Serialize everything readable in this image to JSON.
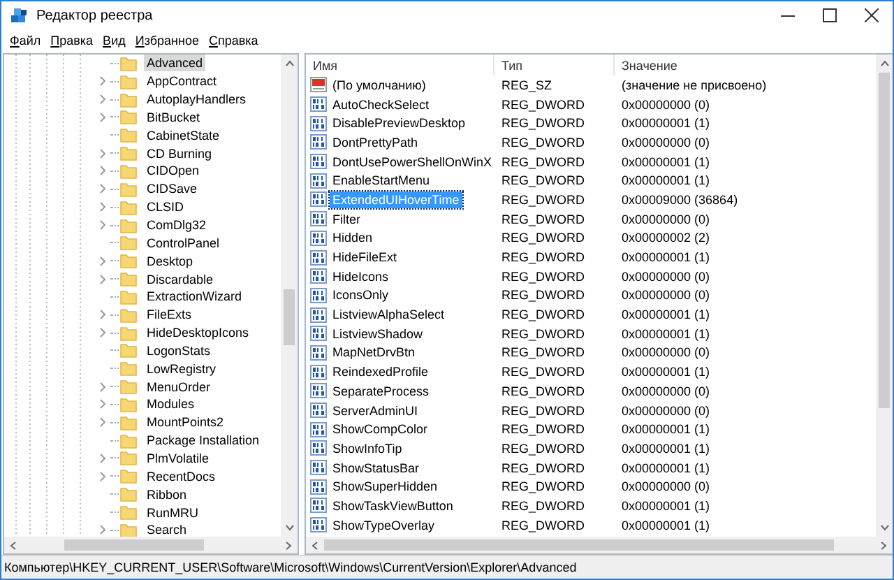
{
  "window": {
    "title": "Редактор реестра"
  },
  "menu": [
    "Файл",
    "Правка",
    "Вид",
    "Избранное",
    "Справка"
  ],
  "tree": [
    {
      "label": "Advanced",
      "expandable": false,
      "selected": true
    },
    {
      "label": "AppContract",
      "expandable": true,
      "selected": false
    },
    {
      "label": "AutoplayHandlers",
      "expandable": true,
      "selected": false
    },
    {
      "label": "BitBucket",
      "expandable": true,
      "selected": false
    },
    {
      "label": "CabinetState",
      "expandable": false,
      "selected": false
    },
    {
      "label": "CD Burning",
      "expandable": true,
      "selected": false
    },
    {
      "label": "CIDOpen",
      "expandable": true,
      "selected": false
    },
    {
      "label": "CIDSave",
      "expandable": true,
      "selected": false
    },
    {
      "label": "CLSID",
      "expandable": true,
      "selected": false
    },
    {
      "label": "ComDlg32",
      "expandable": true,
      "selected": false
    },
    {
      "label": "ControlPanel",
      "expandable": false,
      "selected": false
    },
    {
      "label": "Desktop",
      "expandable": true,
      "selected": false
    },
    {
      "label": "Discardable",
      "expandable": true,
      "selected": false
    },
    {
      "label": "ExtractionWizard",
      "expandable": false,
      "selected": false
    },
    {
      "label": "FileExts",
      "expandable": true,
      "selected": false
    },
    {
      "label": "HideDesktopIcons",
      "expandable": true,
      "selected": false
    },
    {
      "label": "LogonStats",
      "expandable": false,
      "selected": false
    },
    {
      "label": "LowRegistry",
      "expandable": false,
      "selected": false
    },
    {
      "label": "MenuOrder",
      "expandable": true,
      "selected": false
    },
    {
      "label": "Modules",
      "expandable": true,
      "selected": false
    },
    {
      "label": "MountPoints2",
      "expandable": true,
      "selected": false
    },
    {
      "label": "Package Installation",
      "expandable": false,
      "selected": false
    },
    {
      "label": "PlmVolatile",
      "expandable": true,
      "selected": false
    },
    {
      "label": "RecentDocs",
      "expandable": true,
      "selected": false
    },
    {
      "label": "Ribbon",
      "expandable": false,
      "selected": false
    },
    {
      "label": "RunMRU",
      "expandable": false,
      "selected": false
    },
    {
      "label": "Search",
      "expandable": true,
      "selected": false
    }
  ],
  "columns": [
    "Имя",
    "Тип",
    "Значение"
  ],
  "values": [
    {
      "kind": "string",
      "name": "(По умолчанию)",
      "type": "REG_SZ",
      "data": "(значение не присвоено)",
      "selected": false
    },
    {
      "kind": "dword",
      "name": "AutoCheckSelect",
      "type": "REG_DWORD",
      "data": "0x00000000 (0)",
      "selected": false
    },
    {
      "kind": "dword",
      "name": "DisablePreviewDesktop",
      "type": "REG_DWORD",
      "data": "0x00000001 (1)",
      "selected": false
    },
    {
      "kind": "dword",
      "name": "DontPrettyPath",
      "type": "REG_DWORD",
      "data": "0x00000000 (0)",
      "selected": false
    },
    {
      "kind": "dword",
      "name": "DontUsePowerShellOnWinX",
      "type": "REG_DWORD",
      "data": "0x00000001 (1)",
      "selected": false
    },
    {
      "kind": "dword",
      "name": "EnableStartMenu",
      "type": "REG_DWORD",
      "data": "0x00000001 (1)",
      "selected": false
    },
    {
      "kind": "dword",
      "name": "ExtendedUIHoverTime",
      "type": "REG_DWORD",
      "data": "0x00009000 (36864)",
      "selected": true
    },
    {
      "kind": "dword",
      "name": "Filter",
      "type": "REG_DWORD",
      "data": "0x00000000 (0)",
      "selected": false
    },
    {
      "kind": "dword",
      "name": "Hidden",
      "type": "REG_DWORD",
      "data": "0x00000002 (2)",
      "selected": false
    },
    {
      "kind": "dword",
      "name": "HideFileExt",
      "type": "REG_DWORD",
      "data": "0x00000001 (1)",
      "selected": false
    },
    {
      "kind": "dword",
      "name": "HideIcons",
      "type": "REG_DWORD",
      "data": "0x00000000 (0)",
      "selected": false
    },
    {
      "kind": "dword",
      "name": "IconsOnly",
      "type": "REG_DWORD",
      "data": "0x00000000 (0)",
      "selected": false
    },
    {
      "kind": "dword",
      "name": "ListviewAlphaSelect",
      "type": "REG_DWORD",
      "data": "0x00000001 (1)",
      "selected": false
    },
    {
      "kind": "dword",
      "name": "ListviewShadow",
      "type": "REG_DWORD",
      "data": "0x00000001 (1)",
      "selected": false
    },
    {
      "kind": "dword",
      "name": "MapNetDrvBtn",
      "type": "REG_DWORD",
      "data": "0x00000000 (0)",
      "selected": false
    },
    {
      "kind": "dword",
      "name": "ReindexedProfile",
      "type": "REG_DWORD",
      "data": "0x00000001 (1)",
      "selected": false
    },
    {
      "kind": "dword",
      "name": "SeparateProcess",
      "type": "REG_DWORD",
      "data": "0x00000000 (0)",
      "selected": false
    },
    {
      "kind": "dword",
      "name": "ServerAdminUI",
      "type": "REG_DWORD",
      "data": "0x00000000 (0)",
      "selected": false
    },
    {
      "kind": "dword",
      "name": "ShowCompColor",
      "type": "REG_DWORD",
      "data": "0x00000001 (1)",
      "selected": false
    },
    {
      "kind": "dword",
      "name": "ShowInfoTip",
      "type": "REG_DWORD",
      "data": "0x00000001 (1)",
      "selected": false
    },
    {
      "kind": "dword",
      "name": "ShowStatusBar",
      "type": "REG_DWORD",
      "data": "0x00000001 (1)",
      "selected": false
    },
    {
      "kind": "dword",
      "name": "ShowSuperHidden",
      "type": "REG_DWORD",
      "data": "0x00000000 (0)",
      "selected": false
    },
    {
      "kind": "dword",
      "name": "ShowTaskViewButton",
      "type": "REG_DWORD",
      "data": "0x00000001 (1)",
      "selected": false
    },
    {
      "kind": "dword",
      "name": "ShowTypeOverlay",
      "type": "REG_DWORD",
      "data": "0x00000001 (1)",
      "selected": false
    }
  ],
  "status_bar": "Компьютер\\HKEY_CURRENT_USER\\Software\\Microsoft\\Windows\\CurrentVersion\\Explorer\\Advanced"
}
